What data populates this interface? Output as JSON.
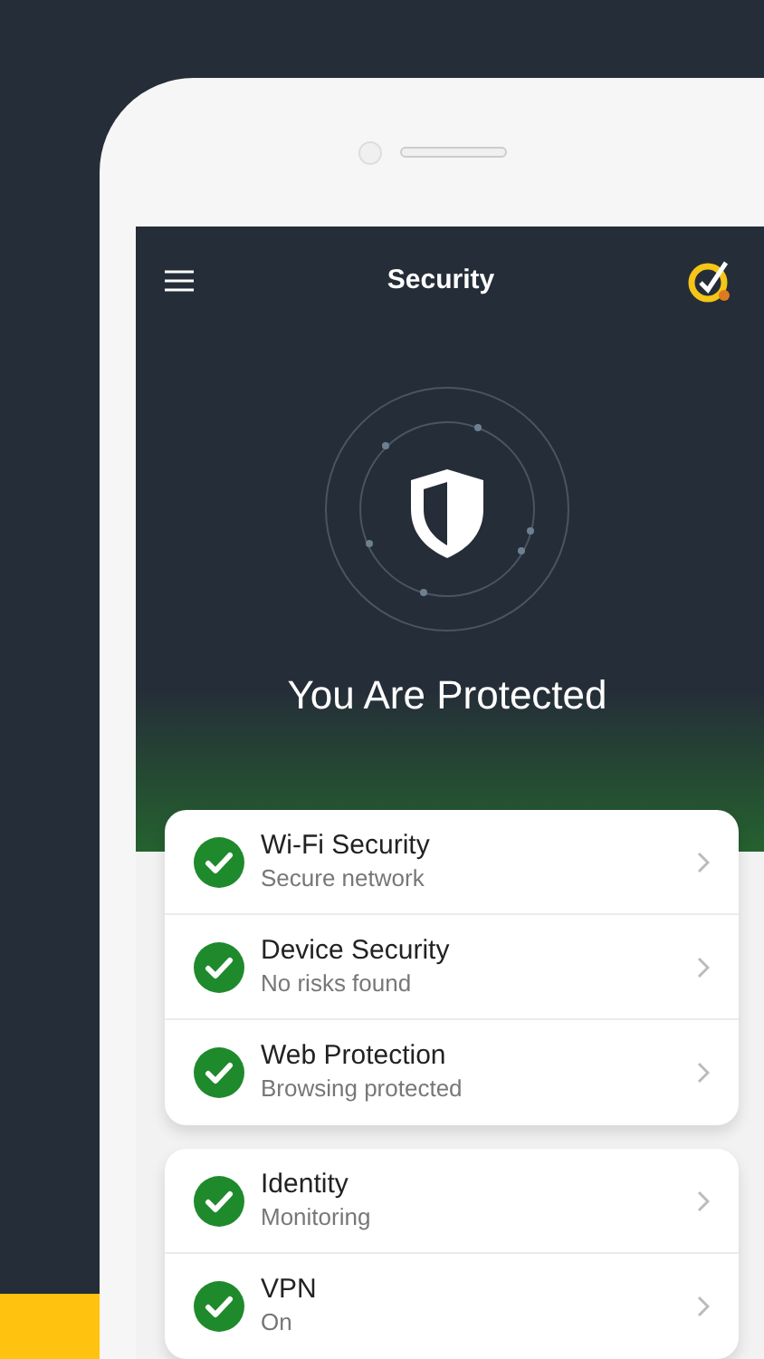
{
  "header": {
    "title": "Security"
  },
  "status": {
    "headline": "You Are Protected"
  },
  "cards": [
    {
      "rows": [
        {
          "title": "Wi-Fi Security",
          "subtitle": "Secure network"
        },
        {
          "title": "Device Security",
          "subtitle": "No risks found"
        },
        {
          "title": "Web Protection",
          "subtitle": "Browsing protected"
        }
      ]
    },
    {
      "rows": [
        {
          "title": "Identity",
          "subtitle": "Monitoring"
        },
        {
          "title": "VPN",
          "subtitle": "On"
        }
      ]
    }
  ]
}
